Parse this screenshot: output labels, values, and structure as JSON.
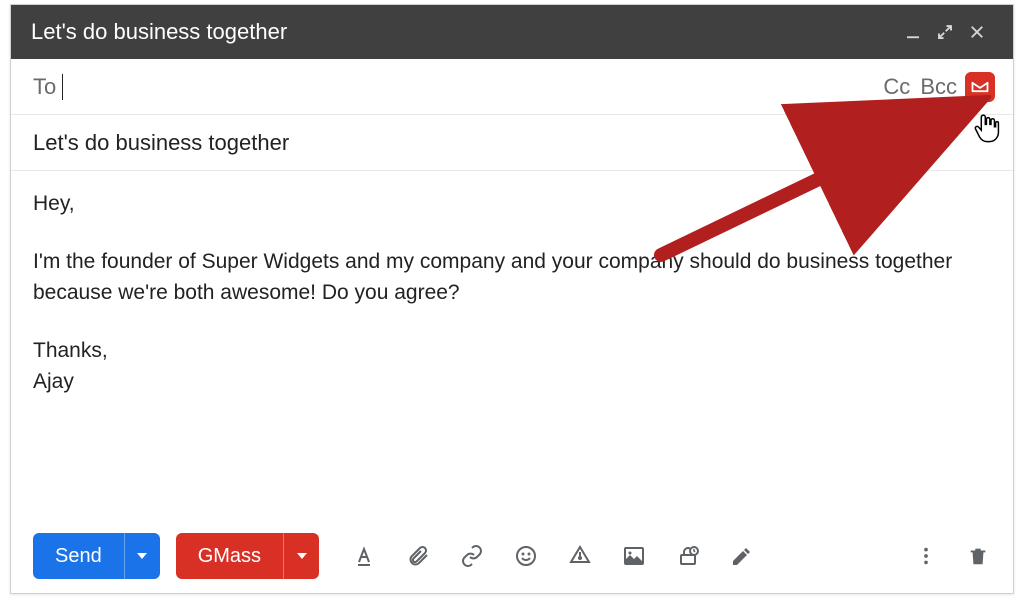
{
  "window": {
    "title": "Let's do business together"
  },
  "recipients": {
    "to_label": "To",
    "to_value": "",
    "cc_label": "Cc",
    "bcc_label": "Bcc"
  },
  "subject": "Let's do business together",
  "body": {
    "greeting": "Hey,",
    "paragraph1": "I'm the founder of Super Widgets and my company and your company should do business together because we're both awesome! Do you agree?",
    "closing": "Thanks,",
    "signature": "Ajay"
  },
  "toolbar": {
    "send_label": "Send",
    "gmass_label": "GMass"
  },
  "colors": {
    "send_blue": "#1a73e8",
    "gmass_red": "#d93025",
    "titlebar": "#404040",
    "icon_gray": "#5f6368"
  },
  "annotation": {
    "target": "gmass-extension-icon",
    "arrow_color": "#c1272d"
  }
}
